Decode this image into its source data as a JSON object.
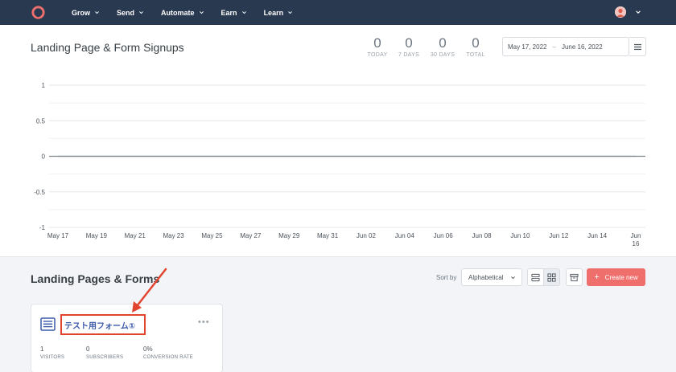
{
  "nav": {
    "items": [
      {
        "label": "Grow"
      },
      {
        "label": "Send"
      },
      {
        "label": "Automate"
      },
      {
        "label": "Earn"
      },
      {
        "label": "Learn"
      }
    ]
  },
  "chart_header": {
    "title": "Landing Page & Form Signups",
    "stats": [
      {
        "value": "0",
        "label": "TODAY"
      },
      {
        "value": "0",
        "label": "7 DAYS"
      },
      {
        "value": "0",
        "label": "30 DAYS"
      },
      {
        "value": "0",
        "label": "TOTAL"
      }
    ],
    "date_start": "May 17, 2022",
    "date_sep": "–",
    "date_end": "June 16, 2022"
  },
  "chart_data": {
    "type": "line",
    "categories": [
      "May 17",
      "May 19",
      "May 21",
      "May 23",
      "May 25",
      "May 27",
      "May 29",
      "May 31",
      "Jun 02",
      "Jun 04",
      "Jun 06",
      "Jun 08",
      "Jun 10",
      "Jun 12",
      "Jun 14",
      "Jun 16"
    ],
    "series": [
      {
        "values": [
          0,
          0,
          0,
          0,
          0,
          0,
          0,
          0,
          0,
          0,
          0,
          0,
          0,
          0,
          0,
          0
        ]
      }
    ],
    "yticks": [
      "1",
      "0.5",
      "0",
      "-0.5",
      "-1"
    ],
    "ylim": [
      -1,
      1
    ],
    "grid": true
  },
  "section": {
    "title": "Landing Pages & Forms",
    "sort_label": "Sort by",
    "sort_value": "Alphabetical",
    "create_label": "Create new",
    "create_plus": "+"
  },
  "card": {
    "title": "テスト用フォーム①",
    "dots": "•••",
    "metrics": [
      {
        "value": "1",
        "label": "VISITORS"
      },
      {
        "value": "0",
        "label": "SUBSCRIBERS"
      },
      {
        "value": "0%",
        "label": "CONVERSION RATE"
      }
    ]
  },
  "colors": {
    "nav_bg": "#293950",
    "accent": "#ef6f6c",
    "highlight": "#e2452f",
    "link": "#3a5aa8"
  }
}
